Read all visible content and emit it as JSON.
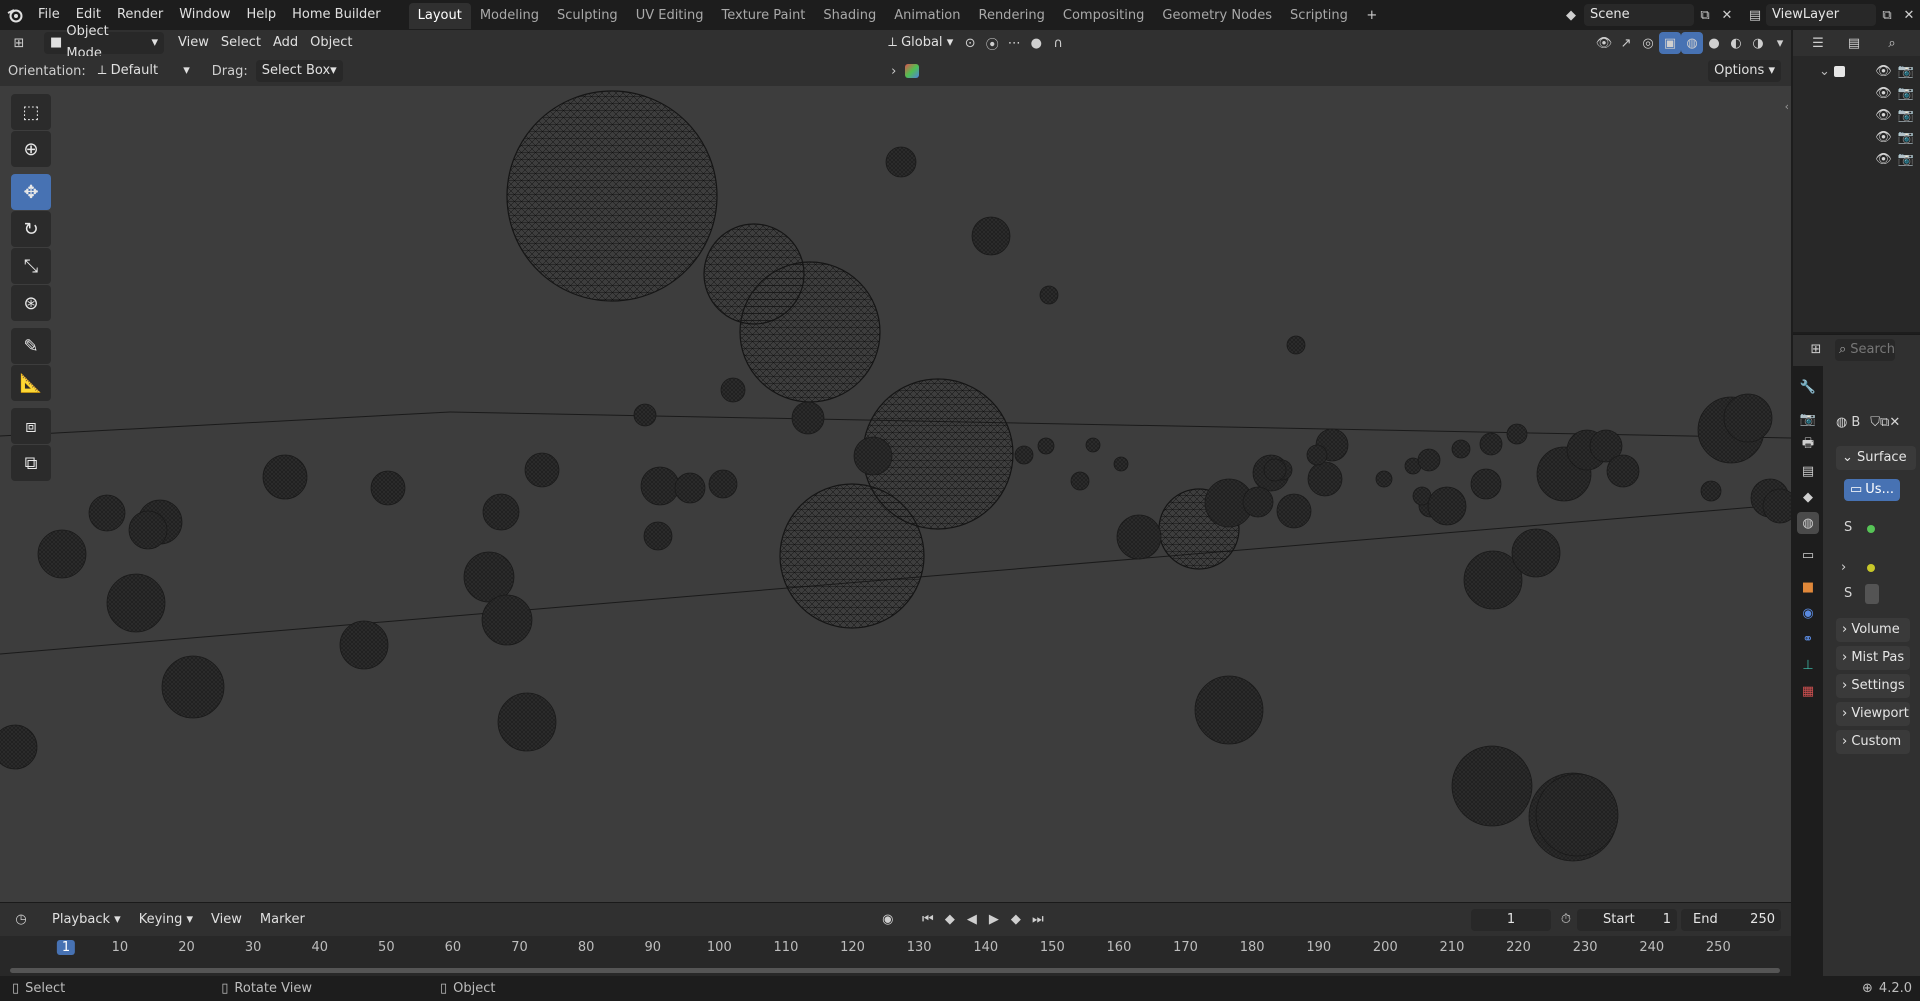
{
  "app": {
    "logo_icon": "blender-logo-icon"
  },
  "menu": [
    "File",
    "Edit",
    "Render",
    "Window",
    "Help",
    "Home Builder"
  ],
  "workspaces": [
    "Layout",
    "Modeling",
    "Sculpting",
    "UV Editing",
    "Texture Paint",
    "Shading",
    "Animation",
    "Rendering",
    "Compositing",
    "Geometry Nodes",
    "Scripting"
  ],
  "active_workspace": "Layout",
  "scene": {
    "label": "Scene",
    "view_layer": "ViewLayer"
  },
  "viewport_header": {
    "mode": "Object Mode",
    "menus": [
      "View",
      "Select",
      "Add",
      "Object"
    ],
    "transform_orientation": "Global"
  },
  "tool_settings": {
    "orientation_label": "Orientation:",
    "orientation_value": "Default",
    "drag_label": "Drag:",
    "drag_value": "Select Box",
    "options_label": "Options"
  },
  "tools": [
    "select-box-icon",
    "cursor-icon",
    "move-icon",
    "rotate-icon",
    "scale-icon",
    "transform-icon",
    "annotate-icon",
    "measure-icon",
    "add-cube-icon",
    "extrude-icon"
  ],
  "active_tool": "move-icon",
  "timeline": {
    "menus": [
      "Playback",
      "Keying",
      "View",
      "Marker"
    ],
    "current_frame": "1",
    "start_label": "Start",
    "start_value": "1",
    "end_label": "End",
    "end_value": "250",
    "ruler": [
      "1",
      "10",
      "20",
      "30",
      "40",
      "50",
      "60",
      "70",
      "80",
      "90",
      "100",
      "110",
      "120",
      "130",
      "140",
      "150",
      "160",
      "170",
      "180",
      "190",
      "200",
      "210",
      "220",
      "230",
      "240",
      "250"
    ]
  },
  "status": {
    "select": "Select",
    "rotate": "Rotate View",
    "object": "Object",
    "version": "4.2.0"
  },
  "properties": {
    "search_placeholder": "Search",
    "world_name": "B",
    "panels": [
      "Surface",
      "Volume",
      "Mist Pas",
      "Settings",
      "Viewport",
      "Custom"
    ],
    "surface_button": "Us...",
    "row_labels": [
      "S",
      "S"
    ]
  }
}
